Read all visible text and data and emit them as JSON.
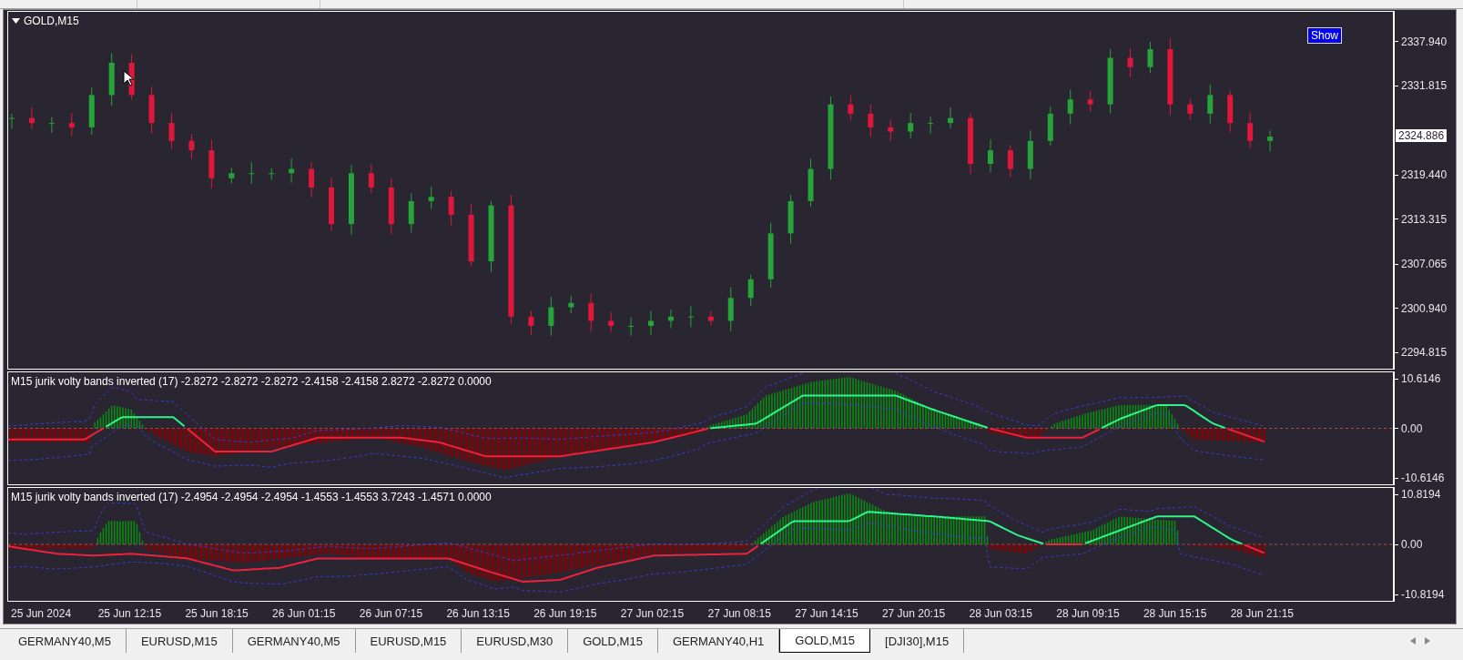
{
  "main_chart": {
    "title": "GOLD,M15",
    "show_button": "Show",
    "current_price": "2324.886",
    "price_axis": [
      "2337.940",
      "2331.815",
      "2319.440",
      "2313.315",
      "2307.065",
      "2300.940",
      "2294.815"
    ]
  },
  "indicators": [
    {
      "label": "M15 jurik volty bands inverted (17) -2.8272 -2.8272 -2.8272 -2.4158 -2.4158 2.8272 -2.8272 0.0000",
      "axis": [
        "10.6146",
        "0.00",
        "-10.6146"
      ]
    },
    {
      "label": "M15 jurik volty bands inverted (17) -2.4954 -2.4954 -2.4954 -1.4553 -1.4553 3.7243 -1.4571 0.0000",
      "axis": [
        "10.8194",
        "0.00",
        "-10.8194"
      ]
    }
  ],
  "time_axis": [
    "25 Jun 2024",
    "25 Jun 12:15",
    "25 Jun 18:15",
    "26 Jun 01:15",
    "26 Jun 07:15",
    "26 Jun 13:15",
    "26 Jun 19:15",
    "27 Jun 02:15",
    "27 Jun 08:15",
    "27 Jun 14:15",
    "27 Jun 20:15",
    "28 Jun 03:15",
    "28 Jun 09:15",
    "28 Jun 15:15",
    "28 Jun 21:15"
  ],
  "tabs": [
    {
      "label": "GERMANY40,M5",
      "selected": false
    },
    {
      "label": "EURUSD,M15",
      "selected": false
    },
    {
      "label": "GERMANY40,M5",
      "selected": false
    },
    {
      "label": "EURUSD,M15",
      "selected": false
    },
    {
      "label": "EURUSD,M30",
      "selected": false
    },
    {
      "label": "GOLD,M15",
      "selected": false
    },
    {
      "label": "GERMANY40,H1",
      "selected": false
    },
    {
      "label": "GOLD,M15",
      "selected": true
    },
    {
      "label": "[DJI30],M15",
      "selected": false
    }
  ]
}
